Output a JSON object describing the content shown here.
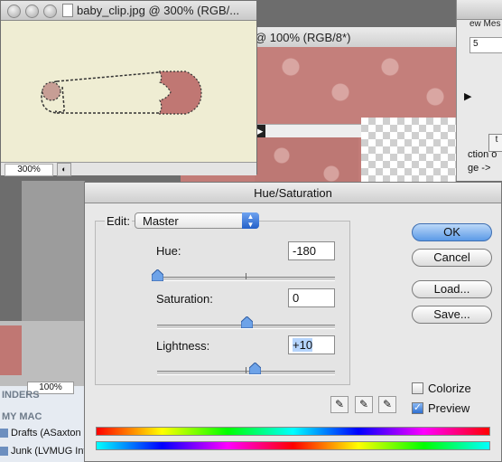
{
  "background": {
    "right_window": {
      "label": "ew Mes",
      "ruler": "5",
      "small_btn": "t",
      "text1": "ction o",
      "text2": "ge ->"
    },
    "doc100_window": {
      "title": "@ 100% (RGB/8*)"
    },
    "baby_window": {
      "title": "baby_clip.jpg @ 300% (RGB/...",
      "zoom": "300%"
    },
    "left_panel": {
      "zoom": "100%",
      "finders_header": "INDERS",
      "mymac_header": "MY MAC",
      "items": [
        "Drafts (ASaxton",
        "Junk (LVMUG Inf"
      ]
    }
  },
  "dialog": {
    "title": "Hue/Saturation",
    "edit_label": "Edit:",
    "edit_value": "Master",
    "hue": {
      "label": "Hue:",
      "value": "-180",
      "level": -180,
      "range": [
        -180,
        180
      ]
    },
    "saturation": {
      "label": "Saturation:",
      "value": "0",
      "level": 0,
      "range": [
        -100,
        100
      ]
    },
    "lightness": {
      "label": "Lightness:",
      "value": "+10",
      "level": 10,
      "range": [
        -100,
        100
      ]
    },
    "buttons": {
      "ok": "OK",
      "cancel": "Cancel",
      "load": "Load...",
      "save": "Save..."
    },
    "colorize": {
      "label": "Colorize",
      "checked": false
    },
    "preview": {
      "label": "Preview",
      "checked": true
    },
    "accent": "#2e6fd0"
  }
}
